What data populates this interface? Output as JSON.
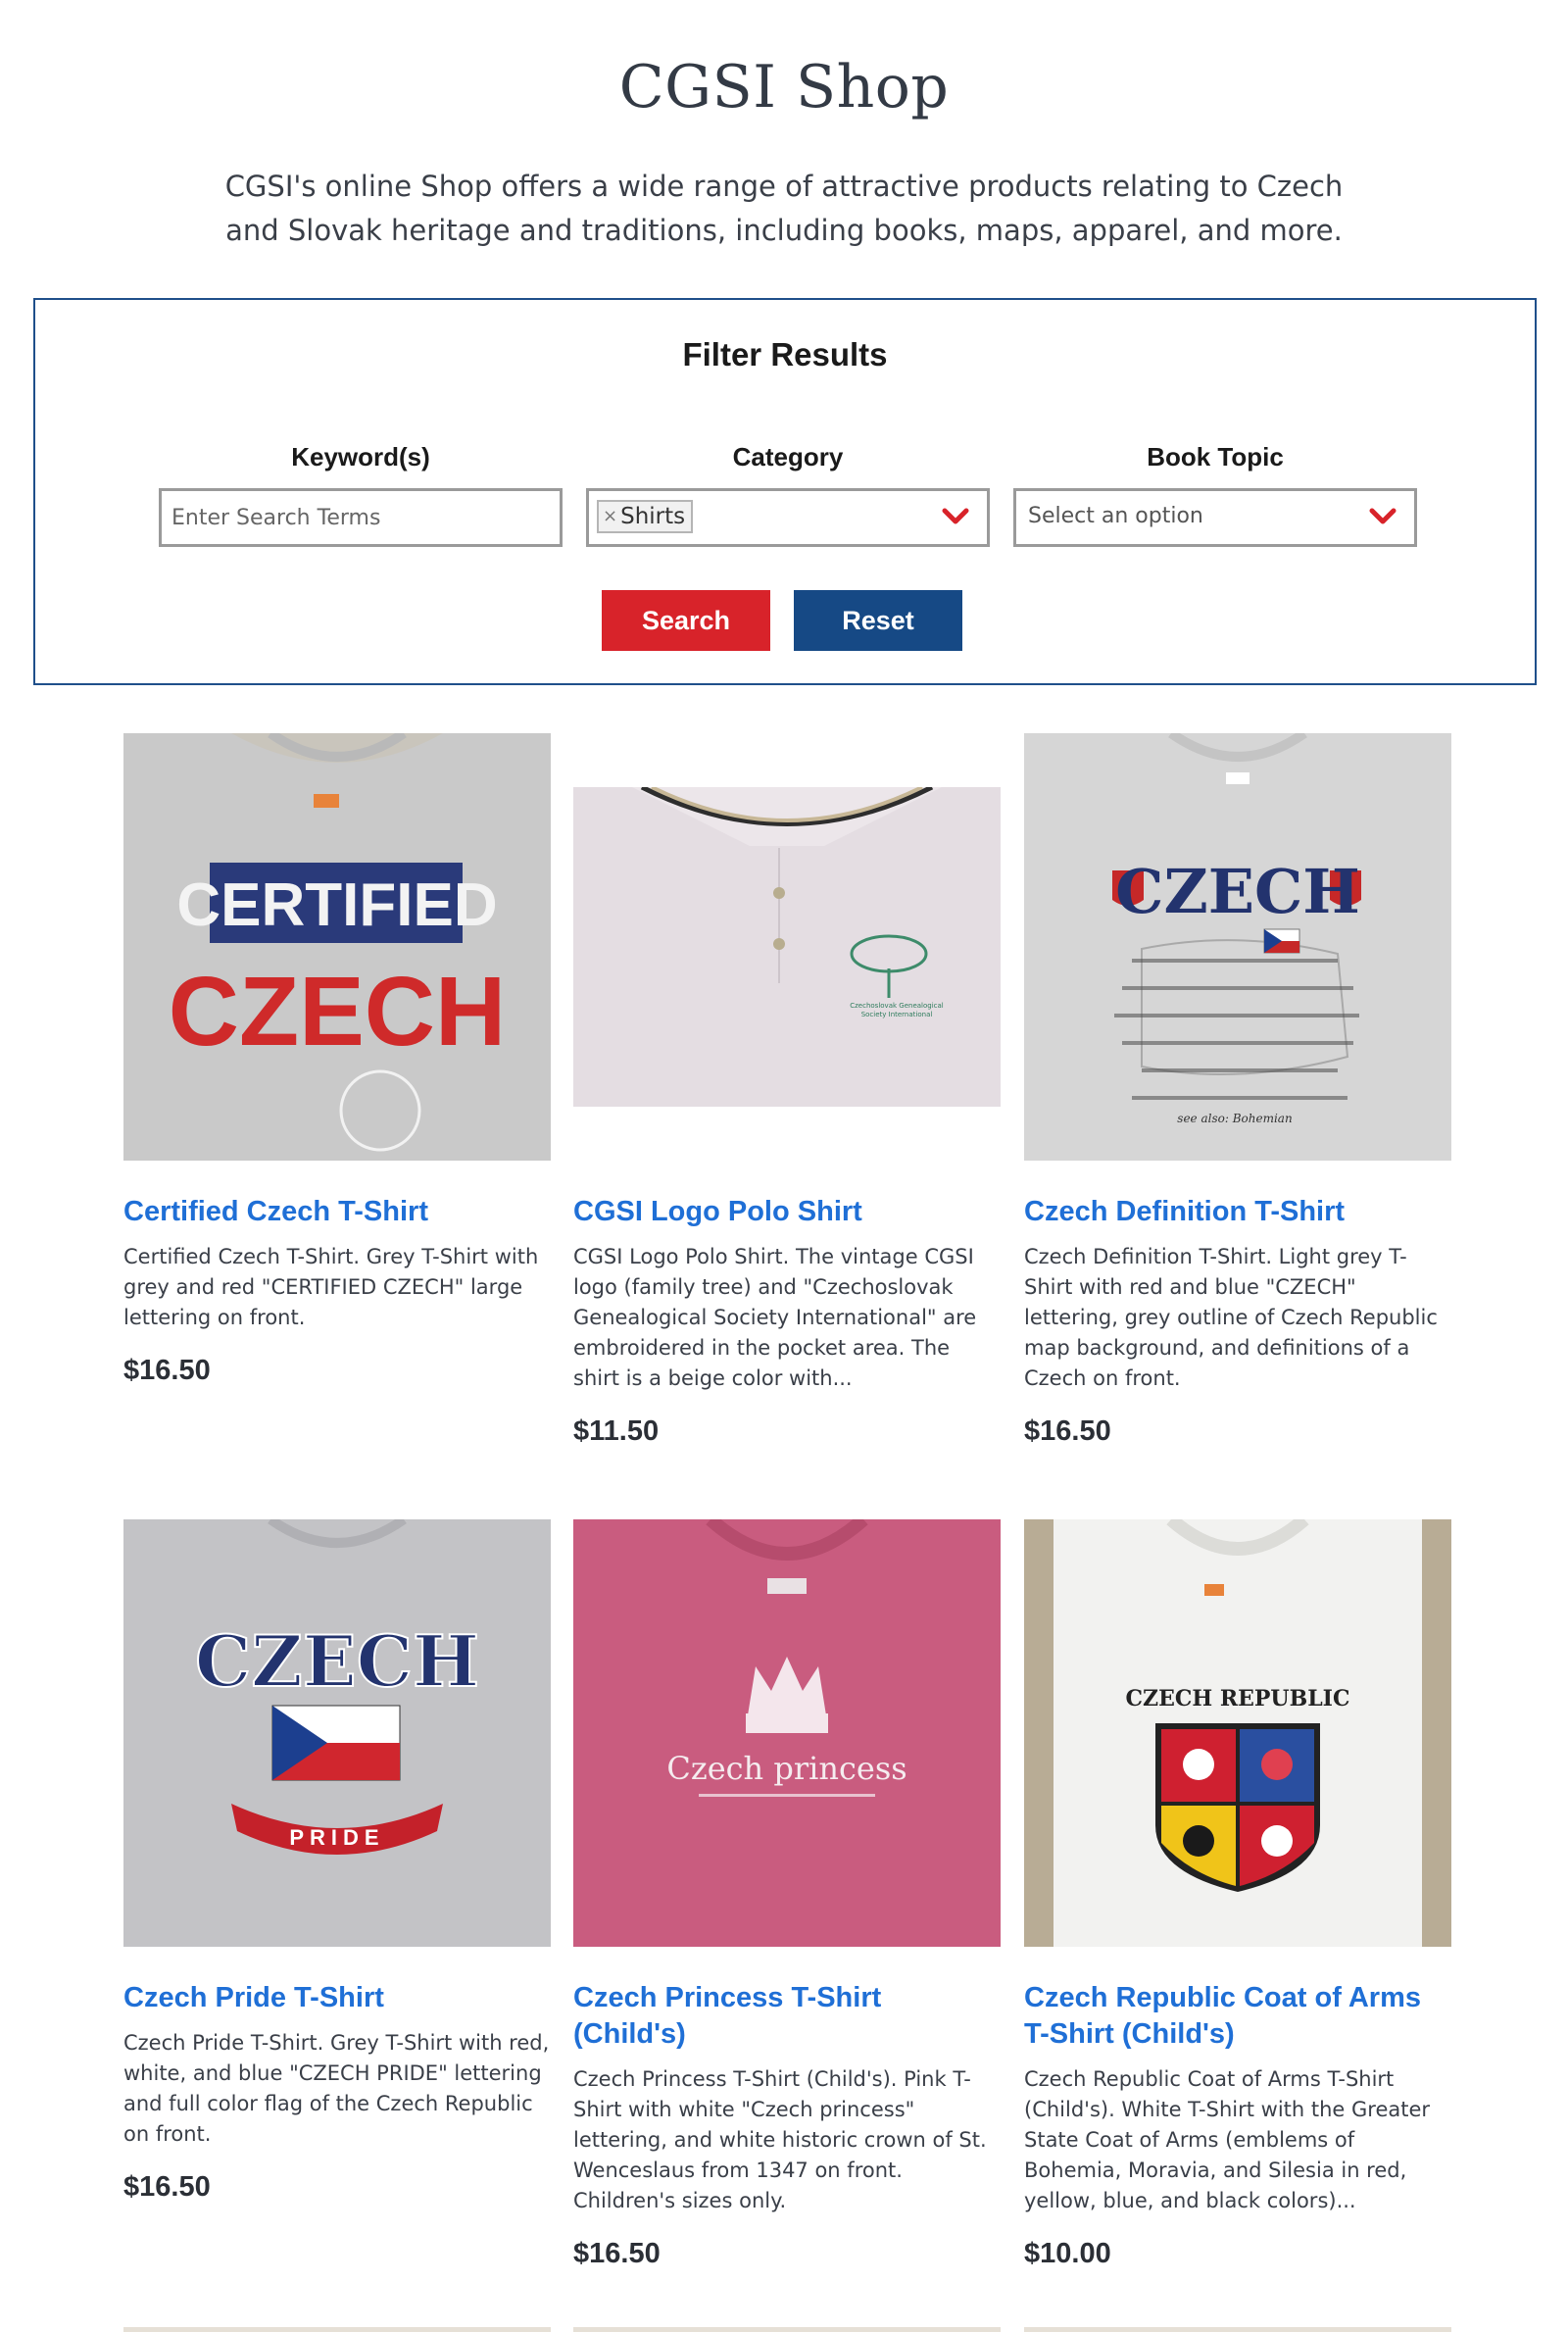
{
  "page": {
    "title": "CGSI Shop",
    "intro": "CGSI's online Shop offers a wide range of attractive products relating to Czech and Slovak heritage and traditions, including books, maps, apparel, and more."
  },
  "filter": {
    "title": "Filter Results",
    "keyword_label": "Keyword(s)",
    "keyword_placeholder": "Enter Search Terms",
    "category_label": "Category",
    "category_selected": "Shirts",
    "category_remove": "×",
    "topic_label": "Book Topic",
    "topic_placeholder": "Select an option",
    "search_label": "Search",
    "reset_label": "Reset"
  },
  "products": [
    {
      "title": "Certified Czech T-Shirt",
      "description": "Certified Czech T-Shirt. Grey T-Shirt with grey and red \"CERTIFIED CZECH\" large lettering on front.",
      "price": "$16.50",
      "print_line1": "CERTIFIED",
      "print_line2": "CZECH"
    },
    {
      "title": "CGSI Logo Polo Shirt",
      "description": "CGSI Logo Polo Shirt. The vintage CGSI logo (family tree) and \"Czechoslovak Genealogical Society International\" are embroidered in the pocket area. The shirt is a beige color with...",
      "price": "$11.50",
      "print_line1": "Czechoslovak Genealogical",
      "print_line2": "Society International"
    },
    {
      "title": "Czech Definition T-Shirt",
      "description": "Czech Definition T-Shirt. Light grey T-Shirt with red and blue \"CZECH\" lettering, grey outline of Czech Republic map background, and definitions of a Czech on front.",
      "price": "$16.50",
      "print_line1": "CZECH",
      "print_line2": "see also: Bohemian"
    },
    {
      "title": "Czech Pride T-Shirt",
      "description": "Czech Pride T-Shirt. Grey T-Shirt with red, white, and blue \"CZECH PRIDE\" lettering and full color flag of the Czech Republic on front.",
      "price": "$16.50",
      "print_line1": "CZECH",
      "print_line2": "PRIDE"
    },
    {
      "title": "Czech Princess T-Shirt (Child's)",
      "description": "Czech Princess T-Shirt (Child's). Pink T-Shirt with white \"Czech princess\" lettering, and white historic crown of St. Wenceslaus from 1347 on front.  Children's sizes only.",
      "price": "$16.50",
      "print_line1": "Czech princess",
      "print_line2": ""
    },
    {
      "title": "Czech Republic Coat of Arms T-Shirt (Child's)",
      "description": "Czech Republic Coat of Arms T-Shirt (Child's). White T-Shirt with the Greater State Coat of Arms (emblems of Bohemia, Moravia, and Silesia in red, yellow, blue, and black colors)...",
      "price": "$10.00",
      "print_line1": "CZECH REPUBLIC",
      "print_line2": ""
    }
  ],
  "colors": {
    "link_blue": "#1f6fd6",
    "search_red": "#d8232a",
    "reset_navy": "#164985",
    "filter_border": "#1f4f8a"
  }
}
